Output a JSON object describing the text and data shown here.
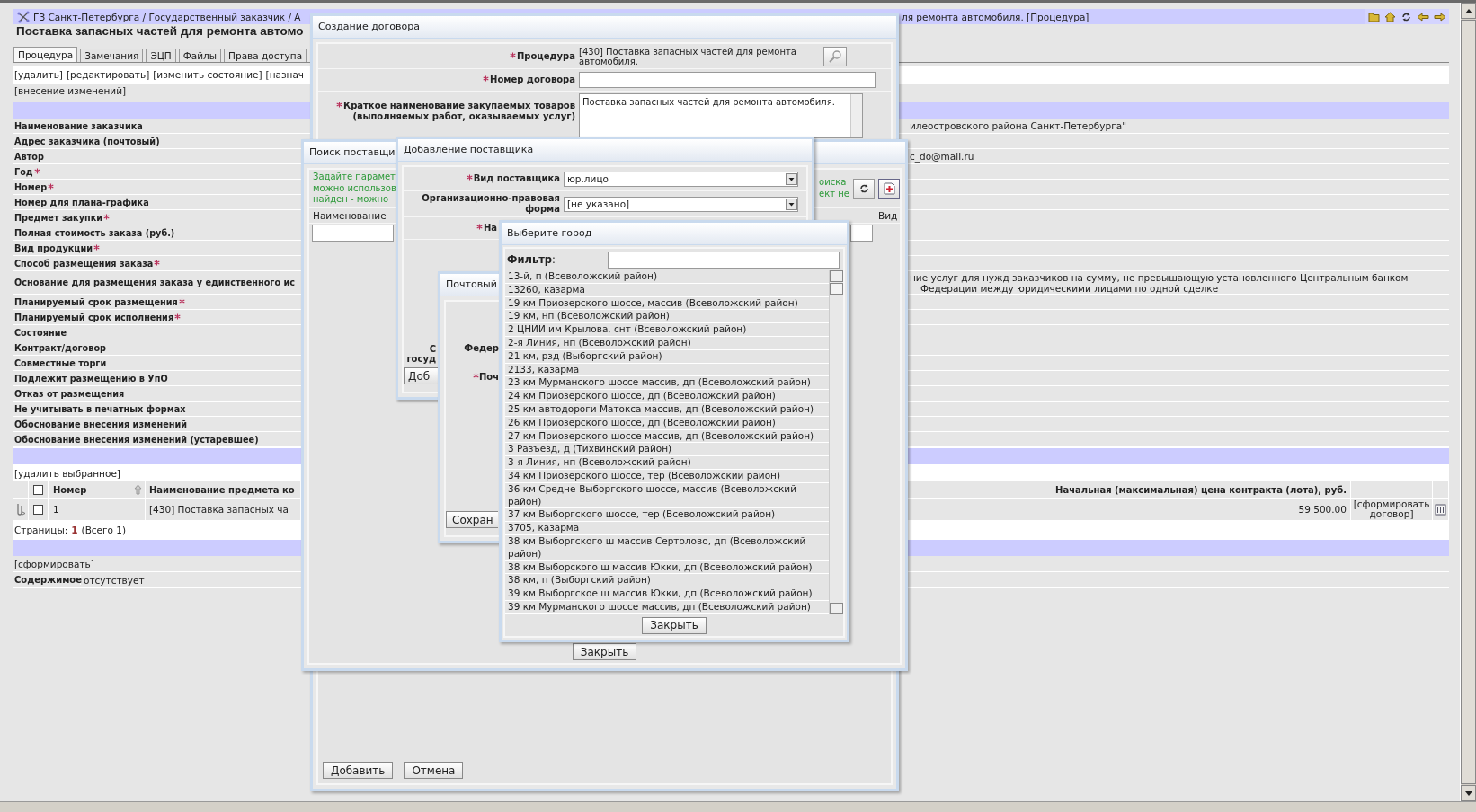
{
  "breadcrumb": {
    "left": "ГЗ Санкт-Петербурга / Государственный заказчик / А",
    "right": "ля ремонта автомобиля. [Процедура]"
  },
  "page_title": "Поставка запасных частей для ремонта автомо",
  "tabs": [
    {
      "label": "Процедура",
      "selected": true
    },
    {
      "label": "Замечания",
      "selected": false
    },
    {
      "label": "ЭЦП",
      "selected": false
    },
    {
      "label": "Файлы",
      "selected": false
    },
    {
      "label": "Права доступа",
      "selected": false
    }
  ],
  "actions": [
    "[удалить]",
    "[редактировать]",
    "[изменить состояние]",
    "[назнач"
  ],
  "actions_2": [
    "[внесение изменений]"
  ],
  "fields": [
    {
      "label": "Наименование заказчика",
      "required": false,
      "value_lines": [
        "илеостровского района Санкт-Петербурга\""
      ]
    },
    {
      "label": "Адрес заказчика (почтовый)",
      "required": false
    },
    {
      "label": "Автор",
      "required": false,
      "value_lines": [
        "c_do@mail.ru"
      ]
    },
    {
      "label": "Год",
      "required": true
    },
    {
      "label": "Номер",
      "required": true
    },
    {
      "label": "Номер для плана-графика",
      "required": false
    },
    {
      "label": "Предмет закупки",
      "required": true
    },
    {
      "label": "Полная стоимость заказа (руб.)",
      "required": false
    },
    {
      "label": "Вид продукции",
      "required": true
    },
    {
      "label": "Способ размещения заказа",
      "required": true
    },
    {
      "label": "Основание для размещения заказа у единственного ис",
      "required": false,
      "value_lines": [
        "ние услуг для нужд заказчиков на сумму, не превышающую установленного Центральным банком",
        "Федерации между юридическими лицами по одной сделке"
      ]
    },
    {
      "label": "Планируемый срок размещения",
      "required": true
    },
    {
      "label": "Планируемый срок исполнения",
      "required": true
    },
    {
      "label": "Состояние",
      "required": false
    },
    {
      "label": "Контракт/договор",
      "required": false
    },
    {
      "label": "Совместные торги",
      "required": false
    },
    {
      "label": "Подлежит размещению в УпО",
      "required": false
    },
    {
      "label": "Отказ от размещения",
      "required": false
    },
    {
      "label": "Не учитывать в печатных формах",
      "required": false
    },
    {
      "label": "Обоснование внесения изменений",
      "required": false
    },
    {
      "label": "Обоснование внесения изменений (устаревшее)",
      "required": false
    }
  ],
  "items_table": {
    "action": "[удалить выбранное]",
    "header_checked": false,
    "columns": [
      "Номер",
      "Наименование предмета ко",
      "Начальная (максимальная) цена контракта (лота), руб."
    ],
    "rows": [
      {
        "checked": false,
        "number": "1",
        "name": "[430] Поставка запасных ча",
        "price": "59 500.00",
        "action": "[сформировать договор]"
      }
    ]
  },
  "pager": {
    "label": "Страницы:",
    "current": "1",
    "total": "(Всего 1)"
  },
  "documents": {
    "action": "[сформировать]",
    "label": "Содержимое",
    "value": "отсутствует"
  },
  "contract_dialog": {
    "title": "Создание договора",
    "fields": [
      {
        "kind": "lookup",
        "label_lines": [
          "Процедура"
        ],
        "required": true,
        "value": "[430] Поставка запасных частей для ремонта автомобиля."
      },
      {
        "kind": "input",
        "label_lines": [
          "Номер договора"
        ],
        "required": true
      },
      {
        "kind": "textarea",
        "label_lines": [
          "Краткое наименование закупаемых товаров",
          "(выполняемых работ, оказываемых услуг)"
        ],
        "required": true,
        "value": "Поставка запасных частей для ремонта автомобиля."
      }
    ],
    "buttons": [
      "Добавить",
      "Отмена"
    ]
  },
  "supplier_search_dialog": {
    "title": "Поиск поставщи",
    "hint_left": [
      "Задайте парамет",
      "можно использов",
      "найден - можно"
    ],
    "hint_right": [
      "оиска",
      "ект не"
    ],
    "columns": [
      "Наименование",
      "Вид"
    ],
    "button": "Закрыть"
  },
  "add_supplier_dialog": {
    "title": "Добавление поставщика",
    "fields": [
      {
        "kind": "select",
        "label": "Вид поставщика",
        "required": true,
        "value": "юр.лицо"
      },
      {
        "kind": "select",
        "label": "Организационно-правовая форма",
        "required": false,
        "value": "[не указано]"
      },
      {
        "kind": "covered",
        "label": "На",
        "required": true
      }
    ],
    "cut_label_lines": [
      "С",
      "госуд"
    ],
    "button": "Доб"
  },
  "postal_dialog": {
    "title": "Почтовый",
    "labels": [
      {
        "text": "Федер",
        "required": false
      },
      {
        "text": "Поч",
        "required": true
      }
    ],
    "button": "Сохран"
  },
  "city_dialog": {
    "title": "Выберите город",
    "filter_label": "**Фильтр**:",
    "cities": [
      "13-й, п (Всеволожский район)",
      "13260, казарма",
      "19 км Приозерского шоссе, массив (Всеволожский район)",
      "19 км, нп (Всеволожский район)",
      "2 ЦНИИ им Крылова, снт (Всеволожский район)",
      "2-я Линия, нп (Всеволожский район)",
      "21 км, рзд (Выборгский район)",
      "2133, казарма",
      "23 км Мурманского шоссе массив, дп (Всеволожский район)",
      "24 км Приозерского шоссе, дп (Всеволожский район)",
      "25 км автодороги Матокса массив, дп (Всеволожский район)",
      "26 км Приозерского шоссе, дп (Всеволожский район)",
      "27 км Приозерского шоссе массив, дп (Всеволожский район)",
      "3 Разъезд, д (Тихвинский район)",
      "3-я Линия, нп (Всеволожский район)",
      "34 км Приозерского шоссе, тер (Всеволожский район)",
      "36 км Средне-Выборгского шоссе, массив (Всеволожский район)",
      "37 км Выборгского шоссе, тер (Всеволожский район)",
      "3705, казарма",
      "38 км Выборгского ш массив Сертолово, дп (Всеволожский район)",
      "38 км Выборского ш массив Юкки, дп (Всеволожский район)",
      "38 км, п (Выборгский район)",
      "39 км Выборгское ш массив Юкки, дп (Всеволожский район)",
      "39 км Мурманского шоссе массив, дп (Всеволожский район)"
    ],
    "button": "Закрыть"
  }
}
